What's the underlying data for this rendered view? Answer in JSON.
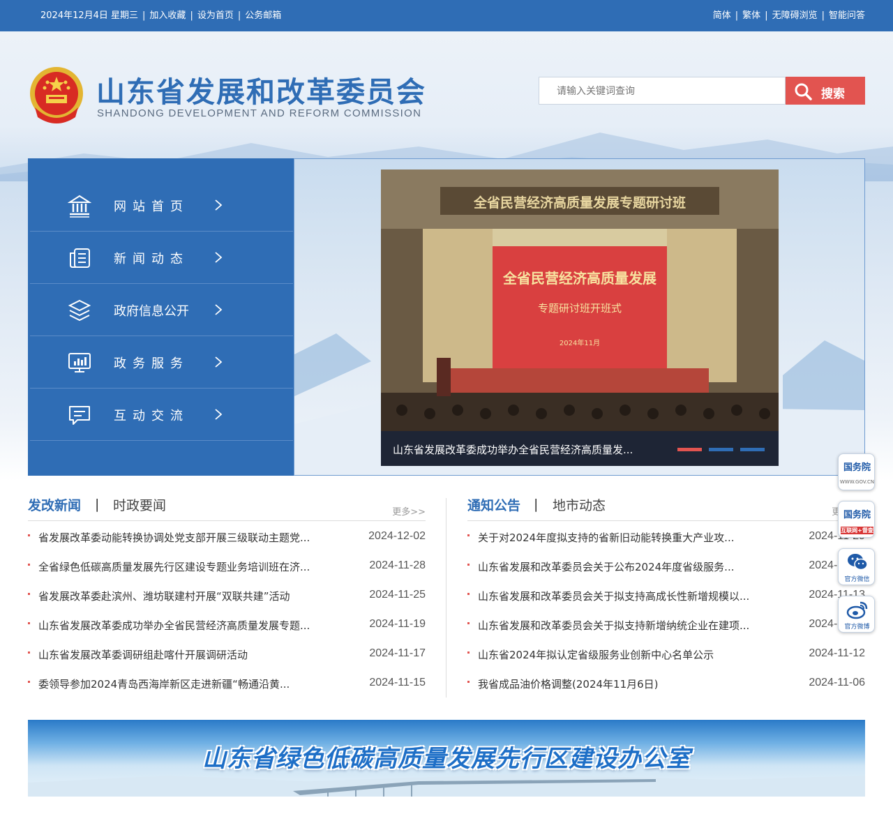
{
  "topbar": {
    "date": "2024年12月4日 星期三",
    "links_left": [
      "加入收藏",
      "设为首页",
      "公务邮箱"
    ],
    "links_right": [
      "简体",
      "繁体",
      "无障碍浏览",
      "智能问答"
    ]
  },
  "header": {
    "title": "山东省发展和改革委员会",
    "subtitle": "SHANDONG DEVELOPMENT AND REFORM COMMISSION"
  },
  "search": {
    "placeholder": "请输入关键词查询",
    "button_label": "搜索"
  },
  "nav": {
    "items": [
      {
        "label": "网站首页",
        "icon": "bank-icon"
      },
      {
        "label": "新闻动态",
        "icon": "news-icon"
      },
      {
        "label": "政府信息公开",
        "icon": "layers-icon"
      },
      {
        "label": "政务服务",
        "icon": "monitor-chart-icon"
      },
      {
        "label": "互动交流",
        "icon": "chat-icon"
      }
    ]
  },
  "banner": {
    "slide_title": "全省民营经济高质量发展专题研讨班",
    "screen_line1": "全省民营经济高质量发展",
    "screen_line2": "专题研讨班开班式",
    "screen_line3": "2024年11月",
    "caption": "山东省发展改革委成功举办全省民营经济高质量发...",
    "dot_colors": [
      "#e25450",
      "#2f6db5",
      "#2f6db5"
    ]
  },
  "news": {
    "tab_active": "发改新闻",
    "tab_other": "时政要闻",
    "more": "更多>>",
    "items": [
      {
        "title": "省发展改革委动能转换协调处党支部开展三级联动主题党...",
        "date": "2024-12-02"
      },
      {
        "title": "全省绿色低碳高质量发展先行区建设专题业务培训班在济...",
        "date": "2024-11-28"
      },
      {
        "title": "省发展改革委赴滨州、潍坊联建村开展“双联共建”活动",
        "date": "2024-11-25"
      },
      {
        "title": "山东省发展改革委成功举办全省民营经济高质量发展专题...",
        "date": "2024-11-19"
      },
      {
        "title": "山东省发展改革委调研组赴喀什开展调研活动",
        "date": "2024-11-17"
      },
      {
        "title": "委领导参加2024青岛西海岸新区走进新疆“畅通沿黄...",
        "date": "2024-11-15"
      }
    ]
  },
  "notices": {
    "tab_active": "通知公告",
    "tab_other": "地市动态",
    "more": "更多>>",
    "items": [
      {
        "title": "关于对2024年度拟支持的省新旧动能转换重大产业攻...",
        "date": "2024-11-29"
      },
      {
        "title": "山东省发展和改革委员会关于公布2024年度省级服务...",
        "date": "2024-11-15"
      },
      {
        "title": "山东省发展和改革委员会关于拟支持高成长性新增规模以...",
        "date": "2024-11-13"
      },
      {
        "title": "山东省发展和改革委员会关于拟支持新增纳统企业在建项...",
        "date": "2024-11-13"
      },
      {
        "title": "山东省2024年拟认定省级服务业创新中心名单公示",
        "date": "2024-11-12"
      },
      {
        "title": "我省成品油价格调整(2024年11月6日)",
        "date": "2024-11-06"
      }
    ]
  },
  "ad_banner": {
    "text": "山东省绿色低碳高质量发展先行区建设办公室"
  },
  "floating": {
    "gov1": {
      "title": "国务院",
      "sub": "WWW.GOV.CN"
    },
    "gov2": {
      "title": "国务院",
      "sub": "互联网+督查"
    },
    "wechat": {
      "label": "官方微信"
    },
    "weibo": {
      "label": "官方微博"
    }
  }
}
